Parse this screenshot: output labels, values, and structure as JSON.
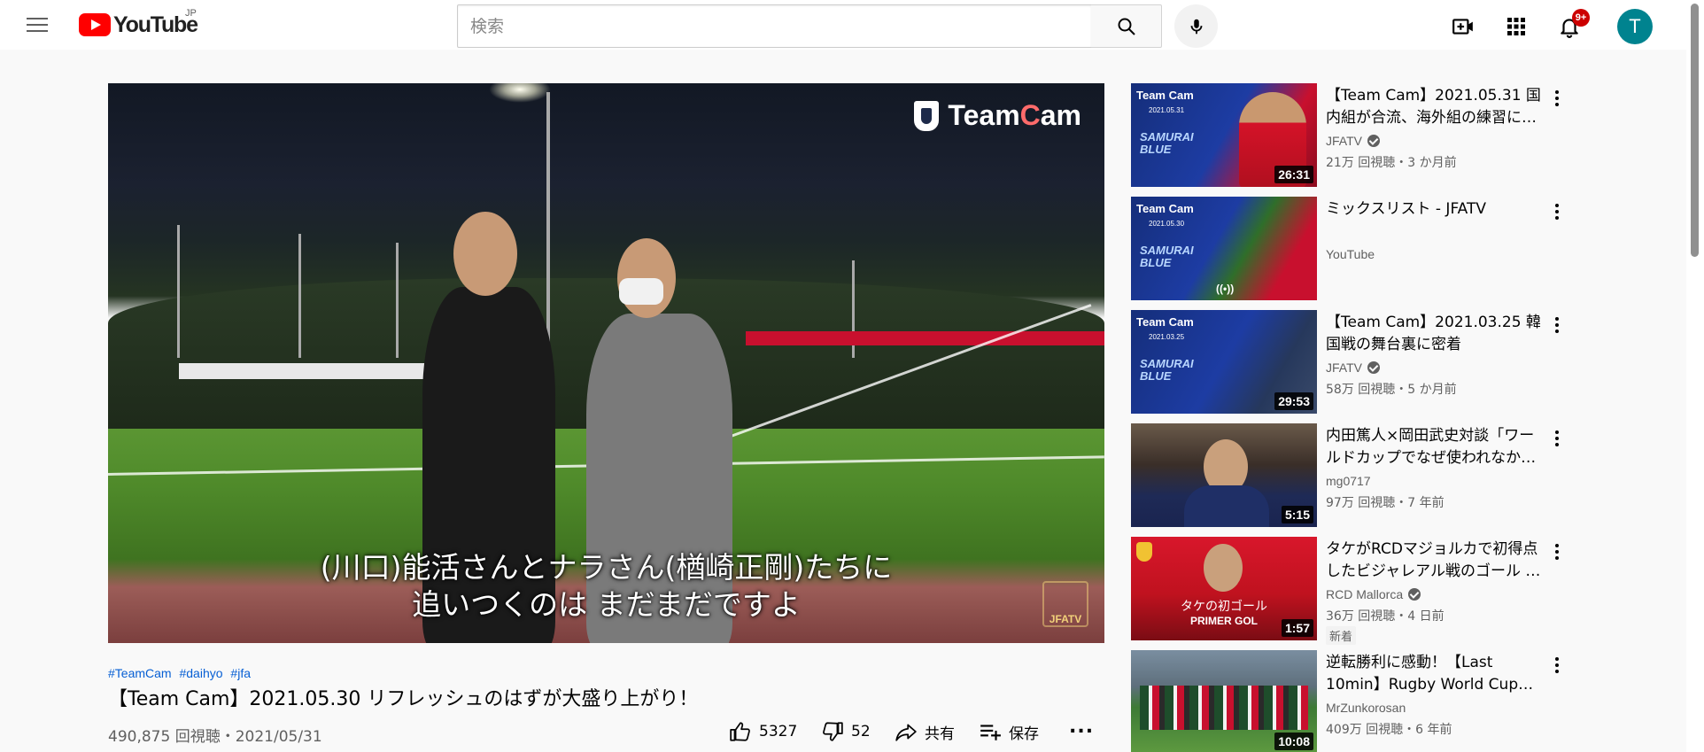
{
  "header": {
    "logo_text": "YouTube",
    "region": "JP",
    "search_placeholder": "検索",
    "notification_count": "9+",
    "avatar_letter": "T"
  },
  "player": {
    "watermark_team": "Team ",
    "watermark_hl": "C",
    "watermark_tail": "am",
    "subtitle_line1": "(川口)能活さんとナラさん(楢崎正剛)たちに",
    "subtitle_line2": "追いつくのは まだまだですよ",
    "corner_logo": "JFATV"
  },
  "video": {
    "hashtags": [
      "#TeamCam",
      "#daihyo",
      "#jfa"
    ],
    "title": "【Team Cam】2021.05.30 リフレッシュのはずが大盛り上がり！",
    "meta": "490,875 回視聴・2021/05/31",
    "like_count": "5327",
    "dislike_count": "52",
    "share_label": "共有",
    "save_label": "保存",
    "more_label": "..."
  },
  "recommendations": [
    {
      "title": "【Team Cam】2021.05.31 国内組が合流、海外組の練習に…",
      "channel": "JFATV",
      "verified": true,
      "views": "21万 回視聴・3 か月前",
      "duration": "26:31",
      "thumb_brand": "Team Cam",
      "thumb_date": "2021.05.31",
      "thumb_line1": "SAMURAI",
      "thumb_line2": "BLUE"
    },
    {
      "title": "ミックスリスト - JFATV",
      "channel": "YouTube",
      "verified": false,
      "views": "",
      "duration": "",
      "thumb_brand": "Team Cam",
      "thumb_date": "2021.05.30",
      "thumb_line1": "SAMURAI",
      "thumb_line2": "BLUE",
      "live_icon": "((•))"
    },
    {
      "title": "【Team Cam】2021.03.25 韓国戦の舞台裏に密着",
      "channel": "JFATV",
      "verified": true,
      "views": "58万 回視聴・5 か月前",
      "duration": "29:53",
      "thumb_brand": "Team Cam",
      "thumb_date": "2021.03.25",
      "thumb_line1": "SAMURAI",
      "thumb_line2": "BLUE"
    },
    {
      "title": "内田篤人×岡田武史対談「ワールドカップでなぜ使われなか…",
      "channel": "mg0717",
      "verified": false,
      "views": "97万 回視聴・7 年前",
      "duration": "5:15"
    },
    {
      "title": "タケがRCDマジョルカで初得点したビジャレアル戦のゴール …",
      "channel": "RCD Mallorca",
      "verified": true,
      "views": "36万 回視聴・4 日前",
      "duration": "1:57",
      "badge": "新着",
      "thumb_caption1": "タケの初ゴール",
      "thumb_caption2": "PRIMER GOL"
    },
    {
      "title": "逆転勝利に感動！【Last 10min】Rugby World Cup…",
      "channel": "MrZunkorosan",
      "verified": false,
      "views": "409万 回視聴・6 年前",
      "duration": "10:08"
    }
  ],
  "colors": {
    "brand_red": "#ff0000",
    "link_blue": "#065fd4",
    "avatar_bg": "#00838f",
    "badge_red": "#cc0000"
  }
}
